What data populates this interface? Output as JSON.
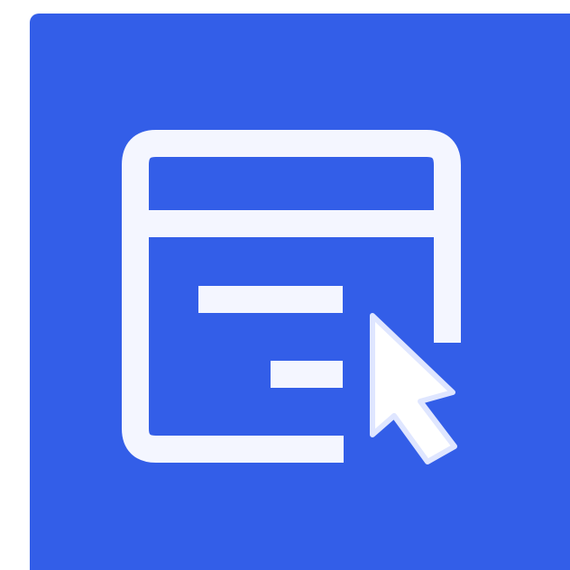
{
  "icon": {
    "semantic_name": "browser-window-cursor-icon",
    "background_color": "#335ee8",
    "foreground_color": "#ffffff"
  }
}
